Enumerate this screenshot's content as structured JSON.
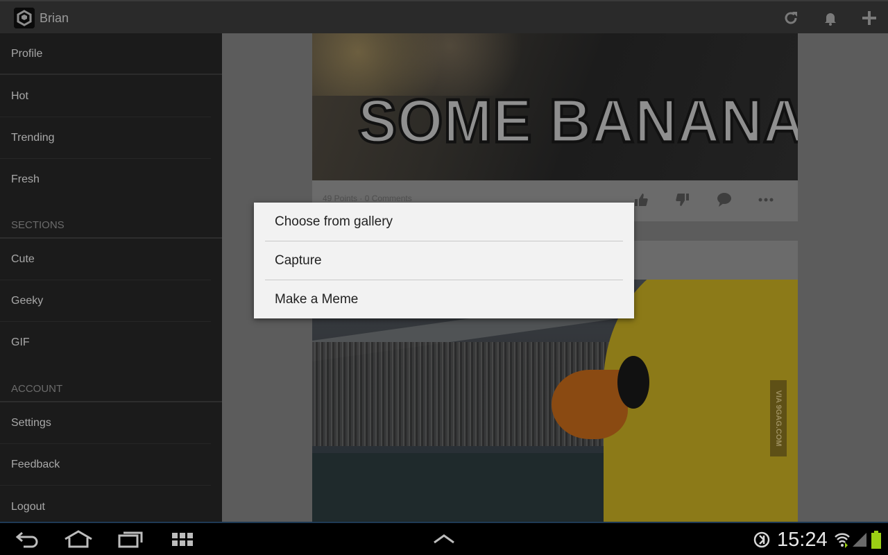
{
  "action_bar": {
    "app_logo_icon": "9gag-logo",
    "username": "Brian",
    "actions": [
      "refresh-icon",
      "notification-bell-icon",
      "add-icon"
    ]
  },
  "drawer": {
    "profile": "Profile",
    "feeds": [
      "Hot",
      "Trending",
      "Fresh"
    ],
    "sections_header": "SECTIONS",
    "sections": [
      "Cute",
      "Geeky",
      "GIF"
    ],
    "account_header": "ACCOUNT",
    "account": [
      "Settings",
      "Feedback",
      "Logout"
    ]
  },
  "feed": {
    "post1": {
      "image_text": "SOME BANANA",
      "meta": "49 Points · 0 Comments"
    },
    "post2": {
      "watermark": "VIA 9GAG.COM"
    }
  },
  "dialog": {
    "options": [
      "Choose from gallery",
      "Capture",
      "Make a Meme"
    ]
  },
  "system_bar": {
    "time": "15:24",
    "nav_buttons": [
      "back-icon",
      "home-icon",
      "recent-apps-icon",
      "app-grid-icon"
    ],
    "status_icons": [
      "data-saver-icon",
      "wifi-icon",
      "signal-icon",
      "battery-icon"
    ]
  },
  "colors": {
    "actionbar": "#2a2a2a",
    "drawer": "#1b1b1b",
    "dim_overlay": "#5c5c5c",
    "dialog": "#f2f2f2",
    "battery": "#9bd014"
  }
}
